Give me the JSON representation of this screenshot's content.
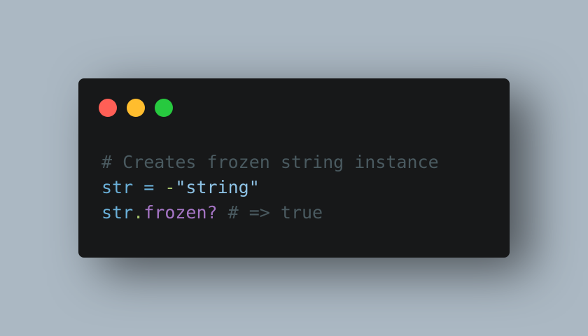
{
  "window": {
    "controls": [
      "close",
      "minimize",
      "maximize"
    ]
  },
  "code": {
    "line1": {
      "comment": "# Creates frozen string instance"
    },
    "line2": {
      "var": "str",
      "assign": " = ",
      "unary": "-",
      "string": "\"string\""
    },
    "line3": {
      "receiver": "str",
      "dot": ".",
      "method": "frozen?",
      "space": " ",
      "comment": "# => true"
    }
  },
  "colors": {
    "background": "#abb8c3",
    "window": "#171819",
    "close": "#ff5f56",
    "minimize": "#ffbd2e",
    "maximize": "#27c93f",
    "comment": "#4a5a60",
    "variable": "#6ab0d9",
    "method": "#a675c6",
    "operator_accent": "#a6c36b"
  }
}
